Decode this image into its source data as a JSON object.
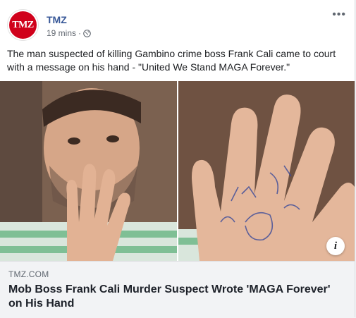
{
  "post": {
    "page_name": "TMZ",
    "avatar_text": "TMZ",
    "timestamp": "19 mins",
    "separator": "·",
    "privacy_icon": "globe-icon",
    "more_icon": "more-options-icon",
    "more_label": "•••",
    "text": "The man suspected of killing Gambino crime boss Frank Cali came to court with a message on his hand - \"United We Stand MAGA Forever.\""
  },
  "link": {
    "domain": "TMZ.COM",
    "headline": "Mob Boss Frank Cali Murder Suspect Wrote 'MAGA Forever' on His Hand",
    "info_label": "i"
  },
  "colors": {
    "brand_red": "#d0011b",
    "page_name_blue": "#385898",
    "card_bg": "#f2f3f5"
  }
}
